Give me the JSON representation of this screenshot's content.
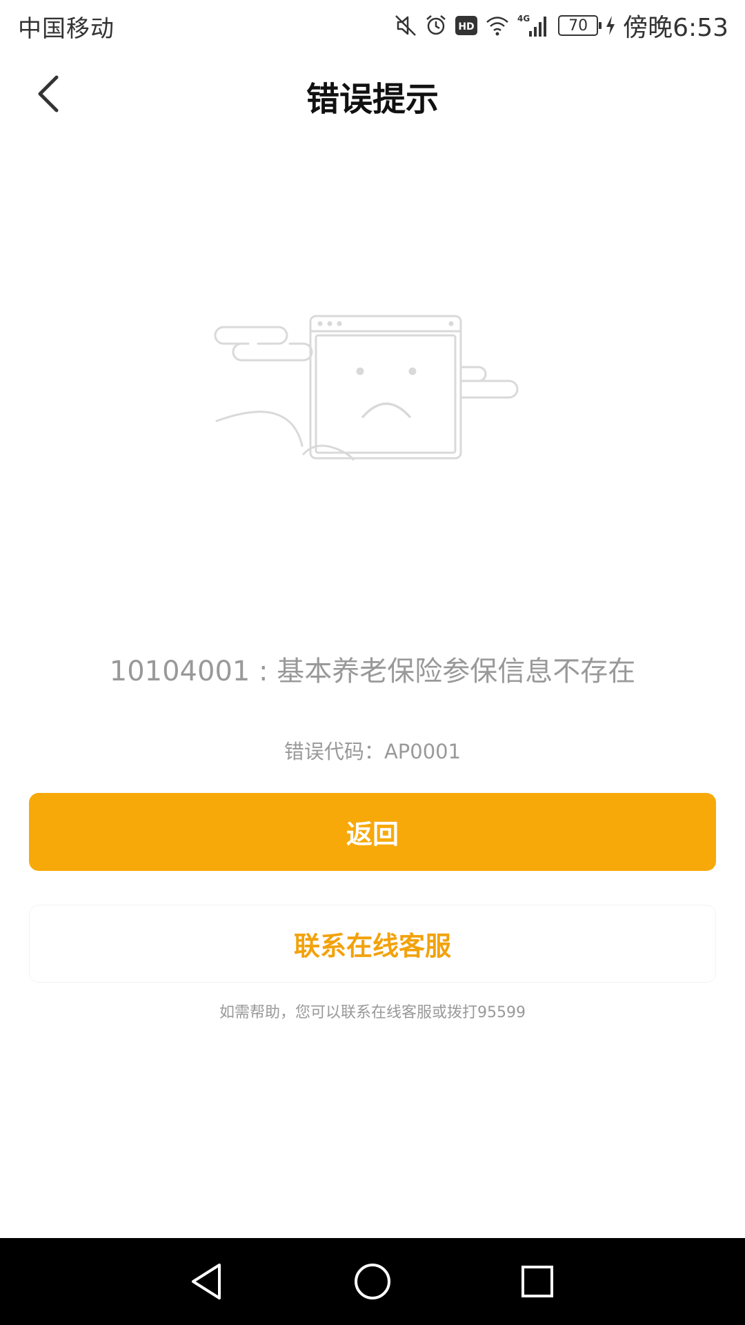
{
  "status_bar": {
    "carrier": "中国移动",
    "network": "4G",
    "battery": "70",
    "time": "傍晚6:53",
    "icons": [
      "mute-icon",
      "alarm-icon",
      "hd-icon",
      "wifi-icon",
      "signal-icon",
      "battery-icon",
      "charging-icon"
    ]
  },
  "header": {
    "title": "错误提示",
    "back_icon": "chevron-left-icon"
  },
  "error": {
    "message": "10104001 : 基本养老保险参保信息不存在",
    "code_label": "错误代码：",
    "code_value": "AP0001"
  },
  "actions": {
    "back_label": "返回",
    "service_label": "联系在线客服"
  },
  "help": {
    "text": "如需帮助，您可以联系在线客服或拨打95599"
  },
  "nav": {
    "back_icon": "triangle-back-icon",
    "home_icon": "circle-home-icon",
    "recent_icon": "square-recent-icon"
  },
  "colors": {
    "primary": "#F8A90A",
    "secondary_text": "#F2A20C",
    "muted_text": "#999999",
    "title_text": "#111111"
  }
}
